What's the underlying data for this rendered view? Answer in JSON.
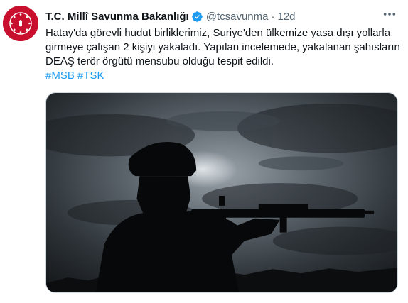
{
  "tweet": {
    "display_name": "T.C. Millî Savunma Bakanlığı",
    "handle": "@tcsavunma",
    "separator": "·",
    "time": "12d",
    "more_icon": "more-horizontal-icon",
    "verified_icon": "verified-badge-icon",
    "text_lines": [
      "Hatay'da görevli hudut birliklerimiz, Suriye'den ülkemize yasa dışı yollarla",
      "girmeye çalışan 2 kişiyi yakaladı. Yapılan incelemede, yakalanan şahısların",
      "DEAŞ terör örgütü mensubu olduğu tespit edildi."
    ],
    "hashtags": [
      "#MSB",
      "#TSK"
    ]
  },
  "colors": {
    "link": "#1d9bf0",
    "verified": "#1d9bf0",
    "avatar_red": "#c8102e",
    "secondary_text": "#536471"
  }
}
